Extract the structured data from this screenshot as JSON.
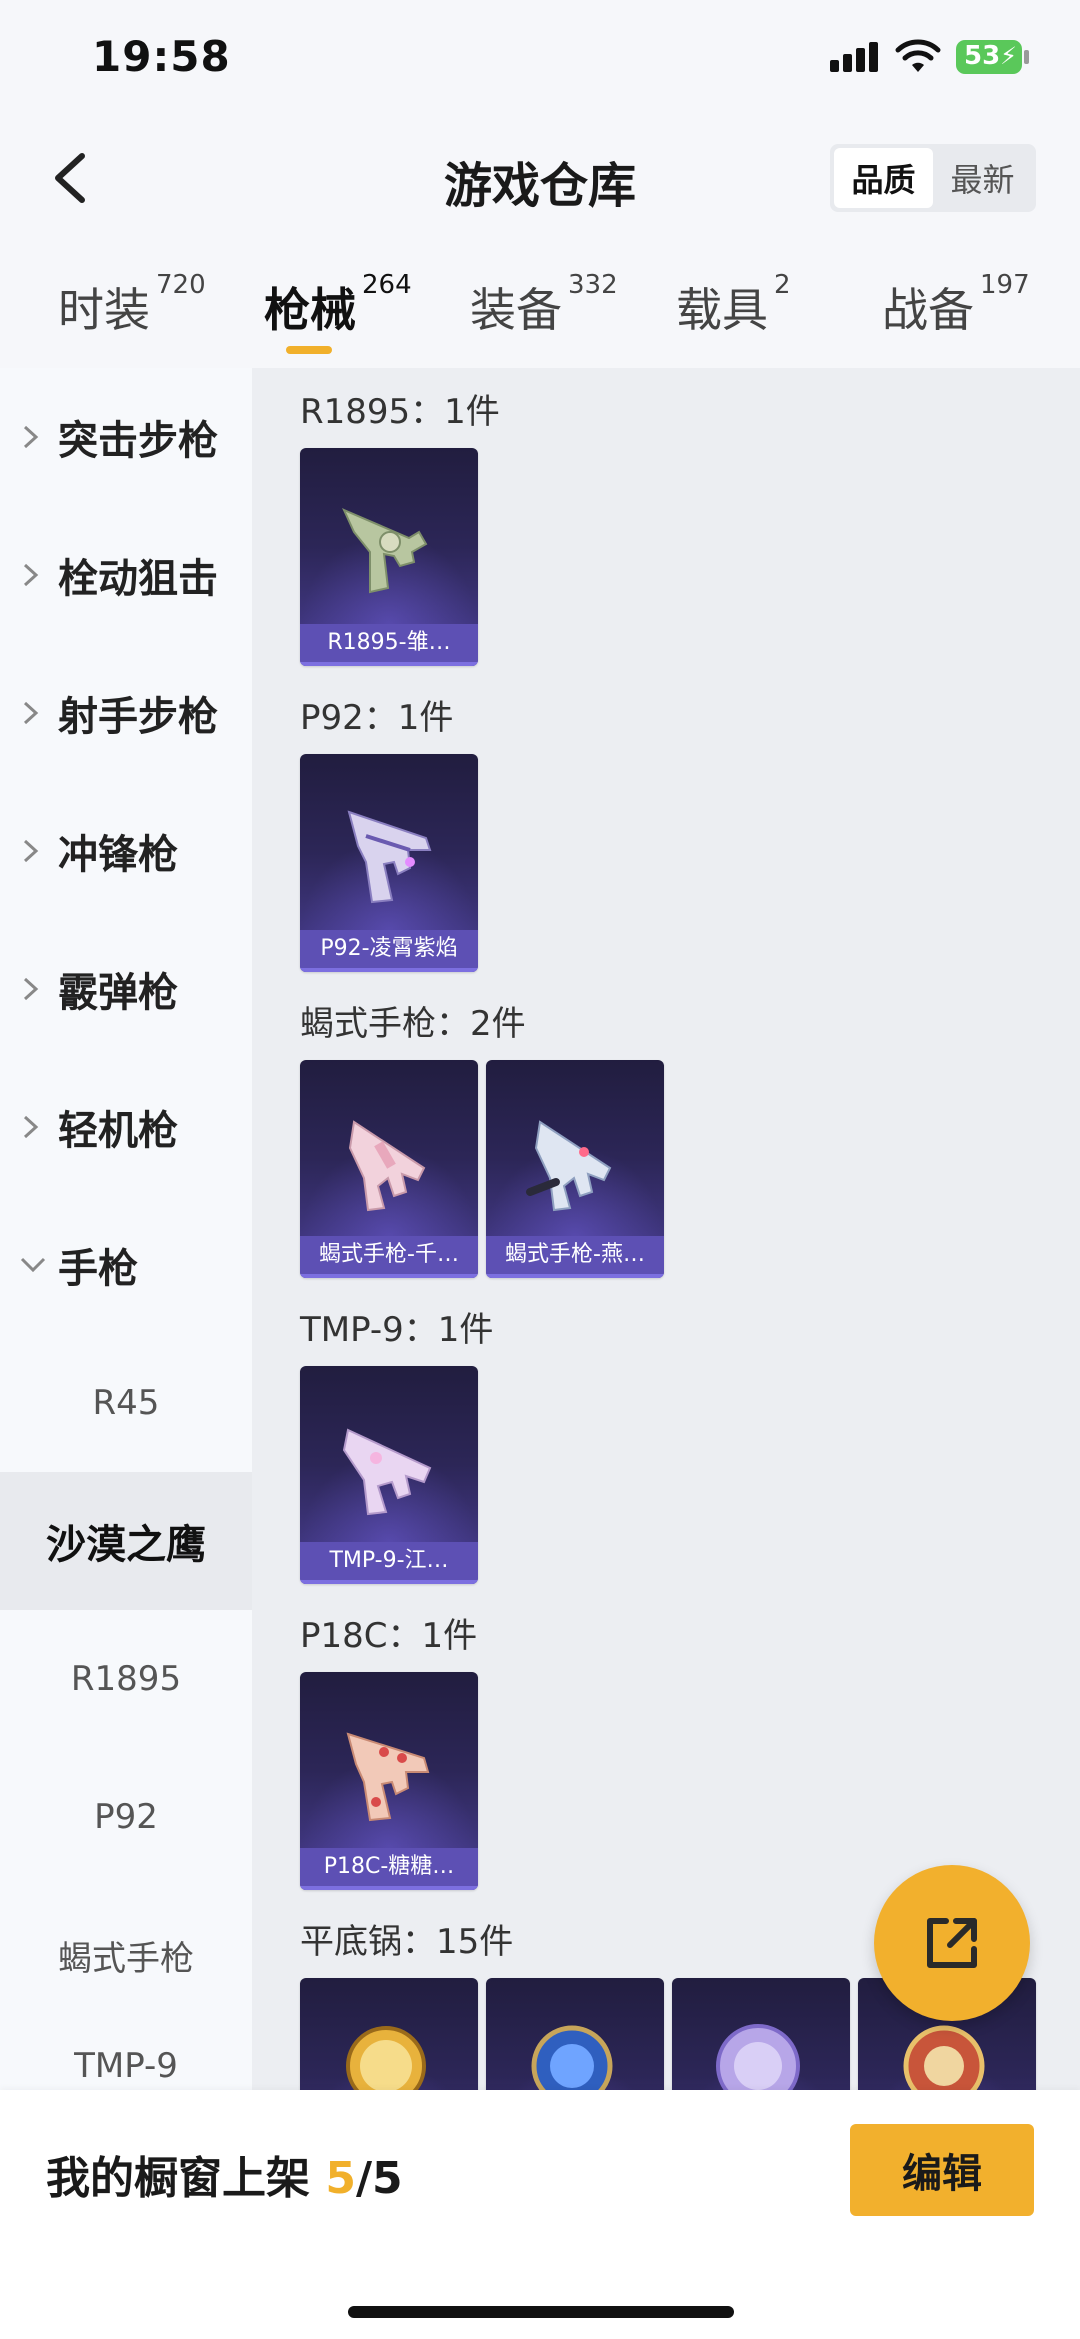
{
  "status_bar": {
    "time": "19:58",
    "battery": "53"
  },
  "header": {
    "title": "游戏仓库",
    "sort_options": [
      "品质",
      "最新"
    ]
  },
  "tabs": [
    {
      "label": "时装",
      "count": "720"
    },
    {
      "label": "枪械",
      "count": "264"
    },
    {
      "label": "装备",
      "count": "332"
    },
    {
      "label": "载具",
      "count": "2"
    },
    {
      "label": "战备",
      "count": "197"
    }
  ],
  "sidebar": {
    "categories": [
      "突击步枪",
      "栓动狙击",
      "射手步枪",
      "冲锋枪",
      "霰弹枪",
      "轻机枪",
      "手枪"
    ],
    "subitems": [
      "R45",
      "沙漠之鹰",
      "R1895",
      "P92",
      "蝎式手枪",
      "TMP-9"
    ]
  },
  "groups": [
    {
      "title": "R1895：1件",
      "items": [
        "R1895-雏…"
      ]
    },
    {
      "title": "P92：1件",
      "items": [
        "P92-凌霄紫焰"
      ]
    },
    {
      "title": "蝎式手枪：2件",
      "items": [
        "蝎式手枪-千…",
        "蝎式手枪-燕…"
      ]
    },
    {
      "title": "TMP-9：1件",
      "items": [
        "TMP-9-江…"
      ]
    },
    {
      "title": "P18C：1件",
      "items": [
        "P18C-糖糖…"
      ]
    },
    {
      "title": "平底锅：15件",
      "items": [
        "",
        "",
        "",
        ""
      ]
    }
  ],
  "bottom_bar": {
    "label": "我的橱窗上架 ",
    "current": "5",
    "total": "/5",
    "edit_label": "编辑"
  },
  "colors": {
    "accent": "#f2b02d",
    "card_bg": "#2c2657",
    "card_label": "#5d50b4"
  }
}
